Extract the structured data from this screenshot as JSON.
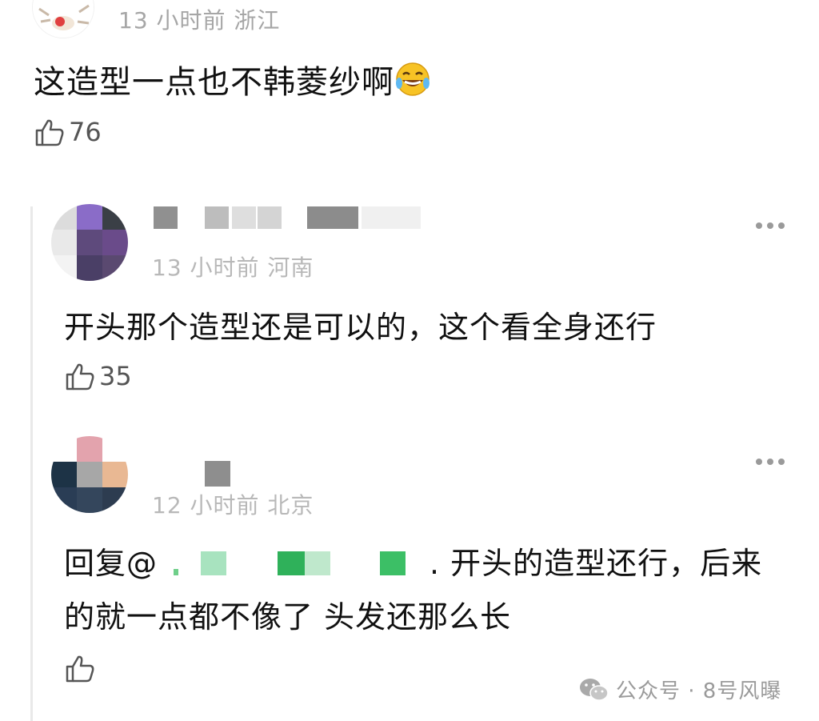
{
  "top_comment": {
    "meta": "13 小时前 浙江",
    "text": "这造型一点也不韩菱纱啊",
    "emoji": "laughing-tears",
    "likes": "76"
  },
  "replies": [
    {
      "meta": "13 小时前 河南",
      "text": "开头那个造型还是可以的，这个看全身还行",
      "likes": "35"
    },
    {
      "meta": "12 小时前 北京",
      "text_line1": "回复@",
      "text_line1_end": ". 开头的造型还行，后来",
      "text_line2": "的就一点都不像了 头发还那么长",
      "likes": ""
    }
  ],
  "watermark": {
    "text": "公众号 · 8号风曝"
  },
  "colors": {
    "meta_gray": "#a6a6a6",
    "mention_green": "#2fb15a"
  }
}
